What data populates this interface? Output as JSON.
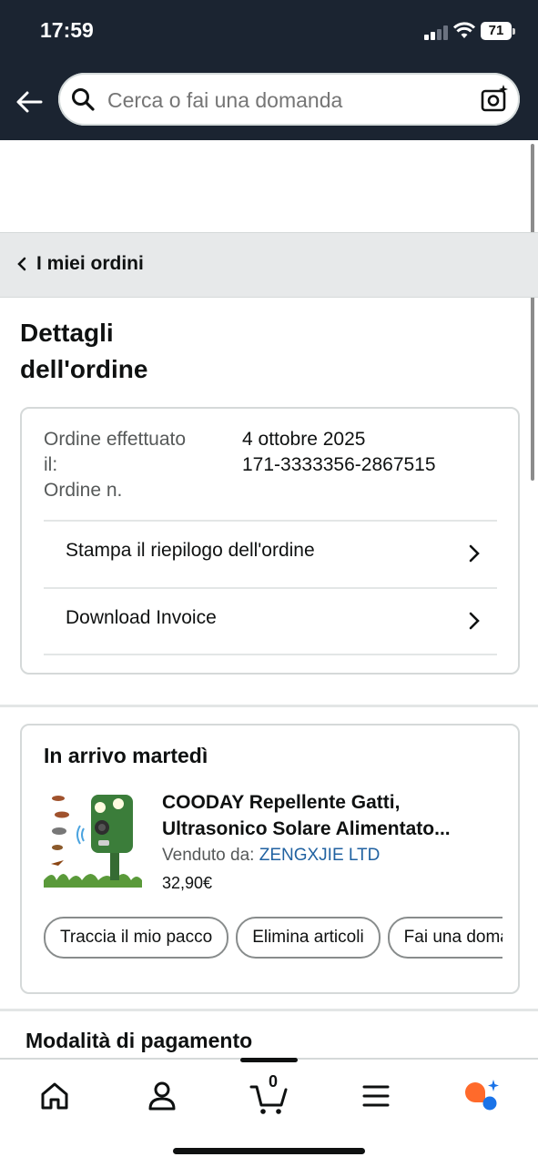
{
  "status_bar": {
    "time": "17:59",
    "battery": "71"
  },
  "search": {
    "placeholder": "Cerca o fai una domanda"
  },
  "breadcrumb": {
    "label": "I miei ordini"
  },
  "page": {
    "title_line1": "Dettagli",
    "title_line2": "dell'ordine"
  },
  "order": {
    "placed_label_line1": "Ordine effettuato",
    "placed_label_line2": "il:",
    "number_label": "Ordine n.",
    "placed_value": "4 ottobre 2025",
    "number_value": "171-3333356-2867515",
    "links": [
      {
        "label": "Stampa il riepilogo dell'ordine"
      },
      {
        "label": "Download Invoice"
      }
    ]
  },
  "delivery": {
    "title": "In arrivo martedì",
    "product": {
      "title_line1": "COODAY Repellente Gatti,",
      "title_line2": "Ultrasonico Solare Alimentato...",
      "seller_label": "Venduto da:",
      "seller_name": "ZENGXJIE LTD",
      "price": "32,90€"
    },
    "actions": [
      "Traccia il mio pacco",
      "Elimina articoli",
      "Fai una domanda"
    ]
  },
  "payment": {
    "title": "Modalità di pagamento"
  },
  "bottom_nav": {
    "cart_count": "0",
    "icons": [
      "home-icon",
      "account-icon",
      "cart-icon",
      "menu-icon",
      "rufus-icon"
    ]
  },
  "colors": {
    "header_bg": "#1b2431",
    "link": "#2162a1",
    "breadcrumb_bg": "#e7e9ea",
    "assistant_orange": "#ff6a2b",
    "assistant_blue": "#1a73e8"
  }
}
